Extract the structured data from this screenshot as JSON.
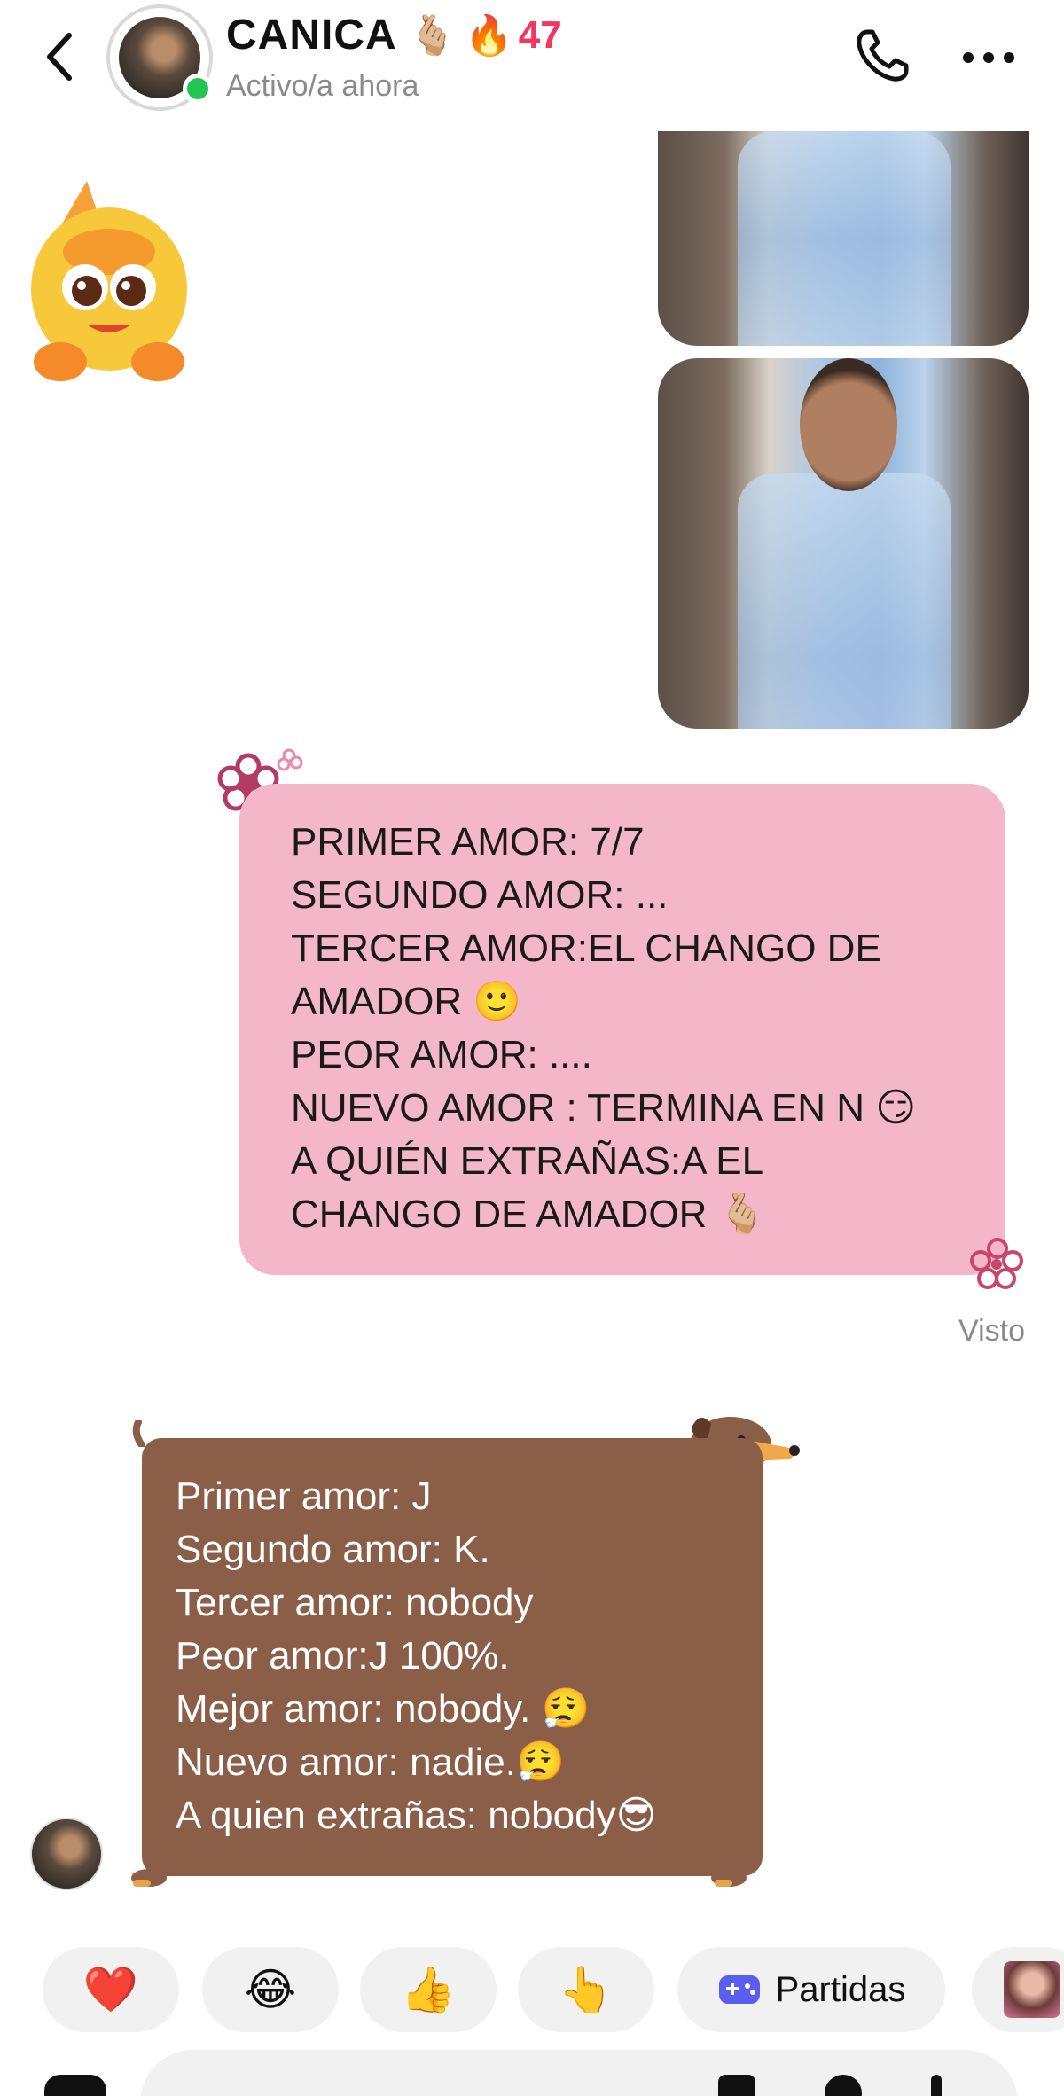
{
  "header": {
    "name": "CANICA",
    "name_emoji": "🫰🏼",
    "streak_icon": "🔥",
    "streak_count": "47",
    "status": "Activo/a ahora",
    "back_icon": "chevron-left-icon",
    "call_icon": "phone-icon",
    "more_icon": "more-horizontal-icon"
  },
  "messages": {
    "sent": {
      "lines": [
        "PRIMER AMOR: 7/7",
        "SEGUNDO AMOR: ...",
        "TERCER AMOR:EL CHANGO DE",
        "AMADOR 🙂",
        "PEOR AMOR: ....",
        "NUEVO AMOR : TERMINA EN N 😏",
        "A QUIÉN EXTRAÑAS:A EL",
        "CHANGO DE AMADOR 🫰🏼"
      ],
      "seen_label": "Visto"
    },
    "received": {
      "lines": [
        "Primer amor: J",
        "Segundo amor: K.",
        "Tercer amor: nobody",
        "Peor amor:J 100%.",
        "Mejor amor: nobody. 😮‍💨",
        "Nuevo amor: nadie.😮‍💨",
        "A quien extrañas: nobody😎"
      ]
    }
  },
  "quick_reactions": {
    "items": [
      "❤️",
      "😂",
      "👍",
      "👆"
    ],
    "games_label": "Partidas"
  },
  "colors": {
    "pink_bubble": "#f4b6c9",
    "brown_bubble": "#8b5e48",
    "online": "#23c552",
    "streak": "#f5365c"
  }
}
